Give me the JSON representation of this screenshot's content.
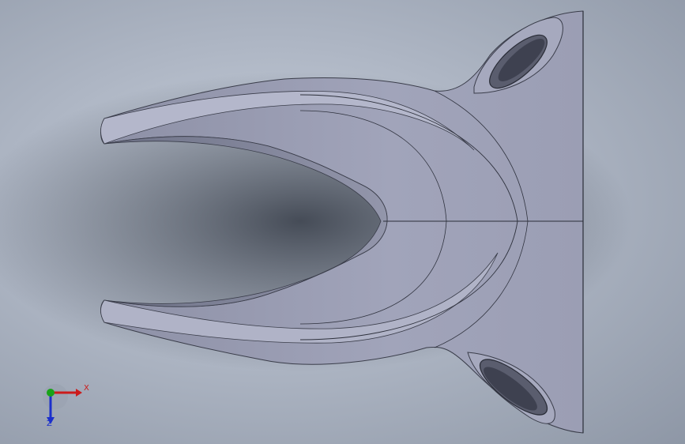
{
  "viewport": {
    "background_color": "#aeb6c4",
    "model_fill_color": "#9fa2b8"
  },
  "triad": {
    "x_label": "X",
    "z_label": "Z",
    "colors": {
      "x_axis": "#cc1b1b",
      "y_axis": "#19a319",
      "z_axis": "#1b2fcc"
    }
  }
}
